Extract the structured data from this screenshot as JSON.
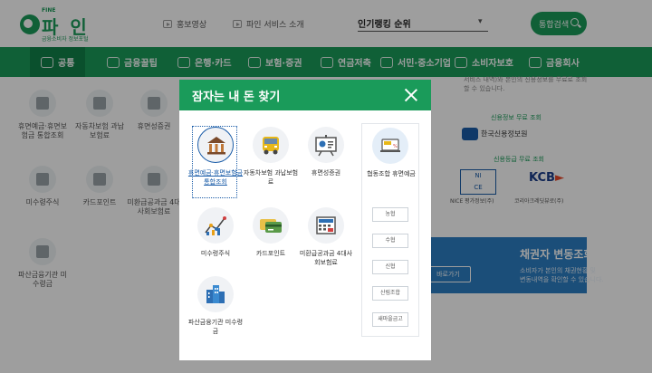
{
  "header": {
    "logo": {
      "fine": "FINE",
      "name": "파 인",
      "sub": "금융소비자 정보포털"
    },
    "links": [
      {
        "label": "홍보영상"
      },
      {
        "label": "파인 서비스 소개"
      }
    ],
    "ranking_label": "인기랭킹 순위",
    "search_button": "통합검색"
  },
  "nav": {
    "items": [
      {
        "label": "공통"
      },
      {
        "label": "금융꿀팁"
      },
      {
        "label": "은행·카드"
      },
      {
        "label": "보험·증권"
      },
      {
        "label": "연금저축"
      },
      {
        "label": "서민·중소기업"
      },
      {
        "label": "소비자보호"
      },
      {
        "label": "금융회사"
      }
    ]
  },
  "background": {
    "items": [
      {
        "label": "휴면예금·휴면보험금 통합조회"
      },
      {
        "label": "자동차보험 과납보험료"
      },
      {
        "label": "휴면성증권"
      },
      {
        "label": "미수령주식"
      },
      {
        "label": "카드포인트"
      },
      {
        "label": "미환급공과금 4대사회보험료"
      },
      {
        "label": "파산금융기관 미수령금"
      }
    ],
    "right_text_1": "서비스 내역)와 본인의 신용정보를 무료로 조회",
    "right_text_2": "할 수 있습니다.",
    "credit_info_title": "신용정보 무료 조회",
    "kcis_name": "한국신용정보원",
    "credit_rating_title": "신용등급 무료 조회",
    "nice_name": "NICE 평가정보(주)",
    "kcb_name": "코리아크레딧뷰로(주)",
    "creditor_title": "채권자 변동조회",
    "creditor_desc_1": "소비자가 본인의 채권현황 및",
    "creditor_desc_2": "변동내역을 확인할 수 있습니다.",
    "creditor_button": "바로가기"
  },
  "modal": {
    "title": "잠자는 내 돈 찾기",
    "items": [
      {
        "label": "휴면예금·휴면보험금 통합조회",
        "icon": "bank-icon",
        "selected": true
      },
      {
        "label": "자동차보험 과납보험료",
        "icon": "bus-icon"
      },
      {
        "label": "휴면성증권",
        "icon": "presentation-chart-icon"
      },
      {
        "label": "미수령주식",
        "icon": "line-chart-icon"
      },
      {
        "label": "카드포인트",
        "icon": "card-icon"
      },
      {
        "label": "미환급공과금 4대사회보험료",
        "icon": "calculator-icon"
      },
      {
        "label": "파산금융기관 미수령금",
        "icon": "buildings-icon"
      }
    ],
    "union": {
      "label": "협동조합 휴면예금",
      "buttons": [
        "농협",
        "수협",
        "신협",
        "산림조합",
        "새마을금고"
      ]
    }
  }
}
